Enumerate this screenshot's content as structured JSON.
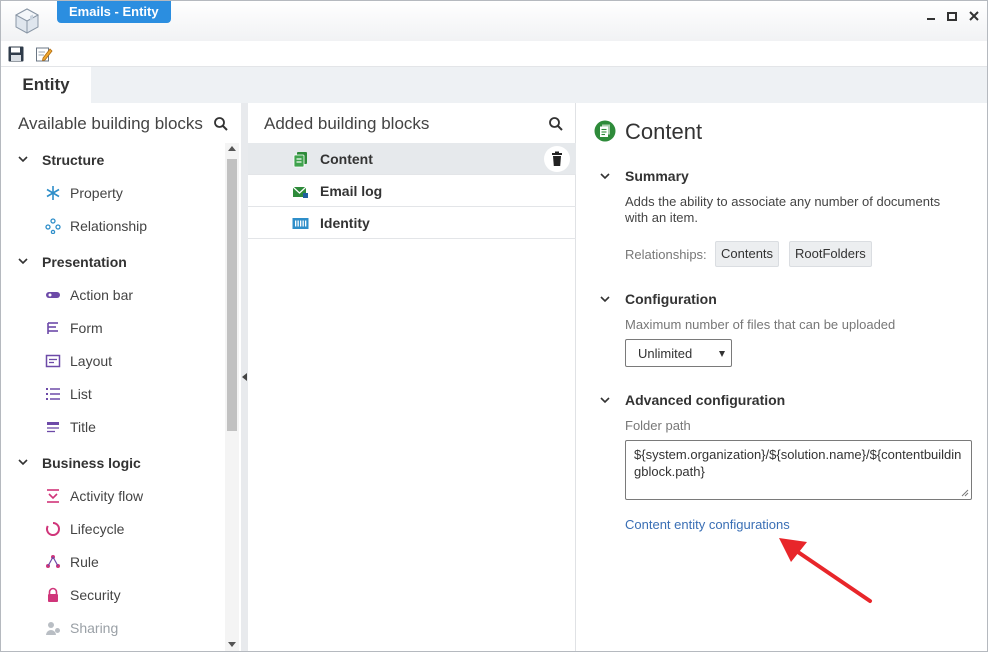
{
  "window": {
    "title": "Emails - Entity",
    "controls": [
      "minimize",
      "maximize",
      "close"
    ]
  },
  "toolbar": {
    "icons": [
      "save-icon",
      "edit-icon"
    ]
  },
  "tabs": [
    {
      "label": "Entity",
      "active": true
    }
  ],
  "available": {
    "title": "Available building blocks",
    "groups": [
      {
        "label": "Structure",
        "items": [
          {
            "label": "Property",
            "icon": "asterisk-icon"
          },
          {
            "label": "Relationship",
            "icon": "relationship-icon"
          }
        ]
      },
      {
        "label": "Presentation",
        "items": [
          {
            "label": "Action bar",
            "icon": "action-bar-icon"
          },
          {
            "label": "Form",
            "icon": "form-icon"
          },
          {
            "label": "Layout",
            "icon": "layout-icon"
          },
          {
            "label": "List",
            "icon": "list-icon"
          },
          {
            "label": "Title",
            "icon": "title-icon"
          }
        ]
      },
      {
        "label": "Business logic",
        "items": [
          {
            "label": "Activity flow",
            "icon": "activity-flow-icon"
          },
          {
            "label": "Lifecycle",
            "icon": "lifecycle-icon"
          },
          {
            "label": "Rule",
            "icon": "rule-icon"
          },
          {
            "label": "Security",
            "icon": "lock-icon"
          },
          {
            "label": "Sharing",
            "icon": "sharing-icon",
            "disabled": true
          }
        ]
      }
    ]
  },
  "added": {
    "title": "Added building blocks",
    "items": [
      {
        "label": "Content",
        "icon": "content-icon",
        "selected": true
      },
      {
        "label": "Email log",
        "icon": "email-log-icon"
      },
      {
        "label": "Identity",
        "icon": "identity-icon"
      }
    ]
  },
  "detail": {
    "title": "Content",
    "summary": {
      "heading": "Summary",
      "description": "Adds the ability to associate any number of documents with an item.",
      "relationships_label": "Relationships:",
      "relationships": [
        "Contents",
        "RootFolders"
      ]
    },
    "configuration": {
      "heading": "Configuration",
      "max_files_label": "Maximum number of files that can be uploaded",
      "max_files_value": "Unlimited"
    },
    "advanced": {
      "heading": "Advanced configuration",
      "folder_path_label": "Folder path",
      "folder_path_value": "${system.organization}/${solution.name}/${contentbuildingblock.path}"
    },
    "link": "Content entity configurations"
  },
  "colors": {
    "title_tab": "#2b8ee0",
    "link": "#3a6fb5",
    "accent_purple": "#6d4aa8",
    "accent_pink": "#d0357a",
    "content_green": "#2e8b3a",
    "annotation_red": "#e8262a"
  }
}
